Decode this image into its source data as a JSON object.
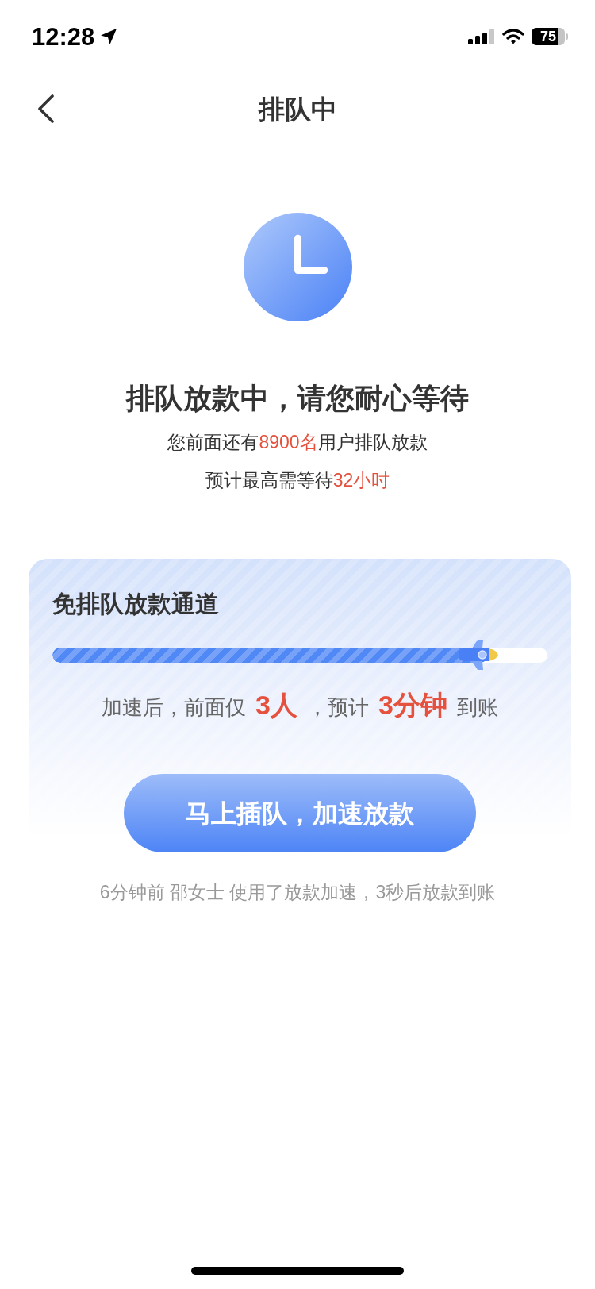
{
  "status_bar": {
    "time": "12:28",
    "battery": "75"
  },
  "nav": {
    "title": "排队中"
  },
  "queue": {
    "heading": "排队放款中，请您耐心等待",
    "lines": [
      {
        "segments": [
          {
            "text": "您前面还有",
            "highlight": false
          },
          {
            "text": "8900名",
            "highlight": true
          },
          {
            "text": "用户排队放款",
            "highlight": false
          }
        ]
      },
      {
        "segments": [
          {
            "text": "预计最高需等待",
            "highlight": false
          },
          {
            "text": "32小时",
            "highlight": true
          }
        ]
      }
    ]
  },
  "fast_lane": {
    "title": "免排队放款通道",
    "progress": {
      "level": 0.88
    },
    "estimate": [
      {
        "text": "加速后，前面仅",
        "highlight": false
      },
      {
        "text": "3人",
        "highlight": true
      },
      {
        "text": "，预计",
        "highlight": false
      },
      {
        "text": "3分钟",
        "highlight": true
      },
      {
        "text": "到账",
        "highlight": false
      }
    ],
    "button": "马上插队，加速放款"
  },
  "footer_note": "6分钟前 邵女士 使用了放款加速，3秒后放款到账"
}
